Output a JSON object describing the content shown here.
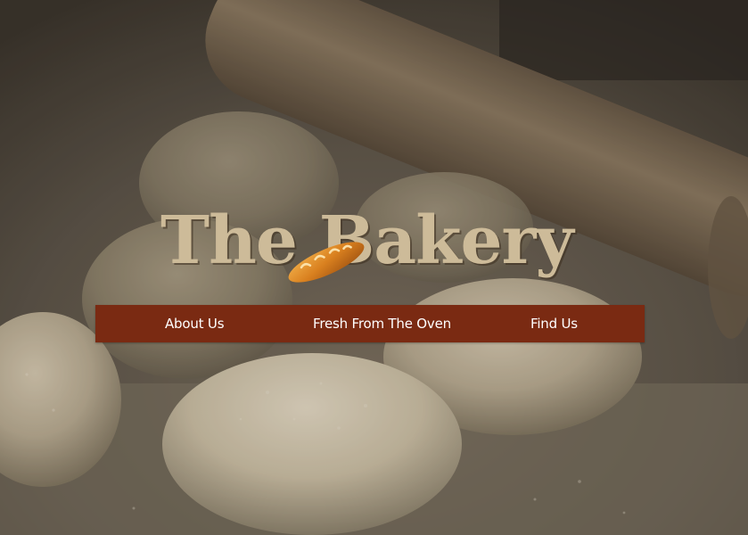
{
  "brand": {
    "title": "The Bakery",
    "logo_icon": "baguette-icon"
  },
  "nav": {
    "items": [
      {
        "label": "About Us"
      },
      {
        "label": "Fresh From The Oven"
      },
      {
        "label": "Find Us"
      }
    ]
  },
  "colors": {
    "nav_background": "#7a2a12",
    "logo_text": "#cdbb99",
    "nav_text": "#ffffff"
  }
}
